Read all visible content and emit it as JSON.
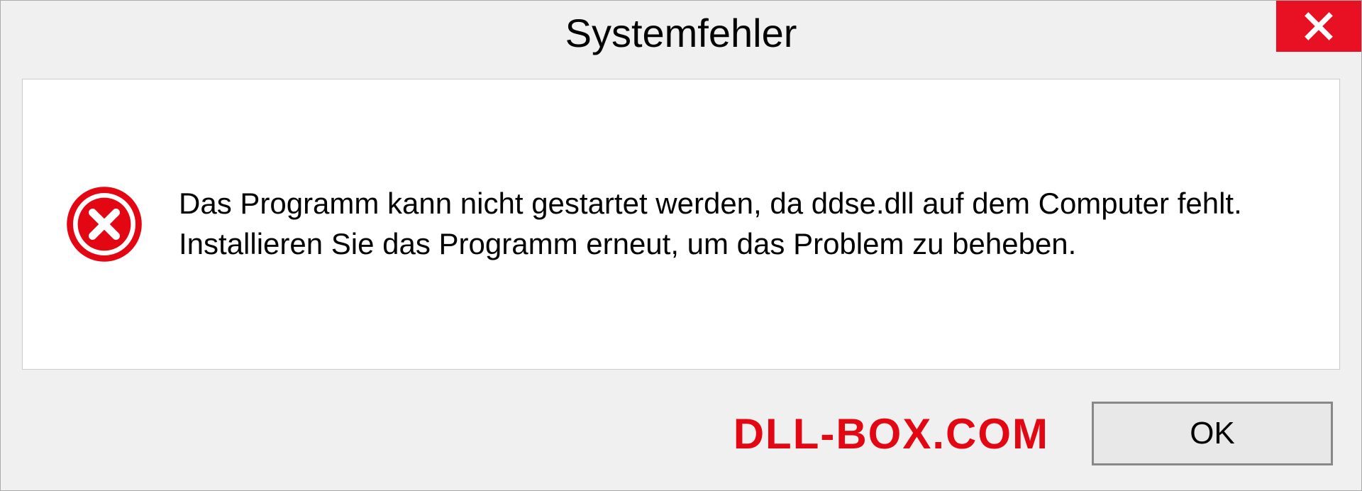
{
  "dialog": {
    "title": "Systemfehler",
    "message": "Das Programm kann nicht gestartet werden, da ddse.dll auf dem Computer fehlt. Installieren Sie das Programm erneut, um das Problem zu beheben.",
    "ok_label": "OK",
    "watermark": "DLL-BOX.COM"
  }
}
